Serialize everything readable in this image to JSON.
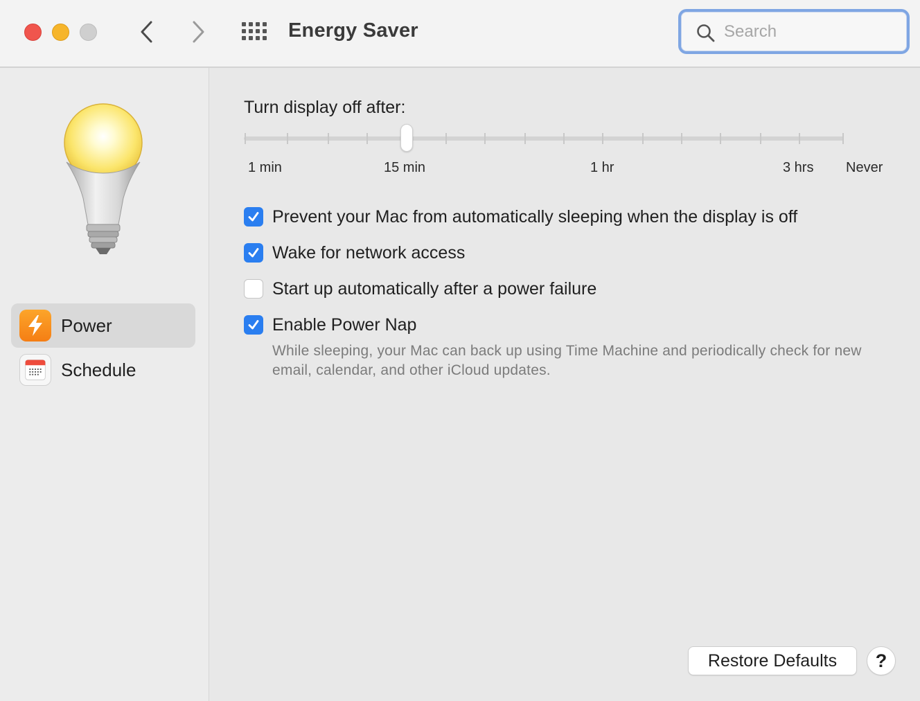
{
  "window": {
    "title": "Energy Saver",
    "traffic_lights": {
      "close": "#f0554d",
      "minimize": "#f6b52b",
      "zoom": "#cfcfcf"
    },
    "nav": {
      "back_icon": "chevron-left-icon",
      "forward_icon": "chevron-right-icon",
      "grid_icon": "show-all-grid-icon"
    }
  },
  "search": {
    "placeholder": "Search",
    "value": "",
    "icon": "search-icon"
  },
  "sidebar": {
    "items": [
      {
        "label": "Power",
        "icon": "power-bolt-icon",
        "selected": true
      },
      {
        "label": "Schedule",
        "icon": "calendar-icon",
        "selected": false
      }
    ]
  },
  "display_sleep": {
    "title": "Turn display off after:",
    "tick_labels": [
      "1 min",
      "15 min",
      "1 hr",
      "3 hrs",
      "Never"
    ],
    "current_value": "15 min"
  },
  "options": [
    {
      "label": "Prevent your Mac from automatically sleeping when the display is off",
      "checked": true
    },
    {
      "label": "Wake for network access",
      "checked": true
    },
    {
      "label": "Start up automatically after a power failure",
      "checked": false
    },
    {
      "label": "Enable Power Nap",
      "checked": true
    }
  ],
  "power_nap_description": "While sleeping, your Mac can back up using Time Machine and periodically check for new email, calendar, and other iCloud updates.",
  "buttons": {
    "restore_defaults": "Restore Defaults",
    "help": "?"
  },
  "colors": {
    "accent": "#2a7ef0",
    "power_icon": "#f57e14",
    "search_focus_ring": "#7fa6e3"
  }
}
